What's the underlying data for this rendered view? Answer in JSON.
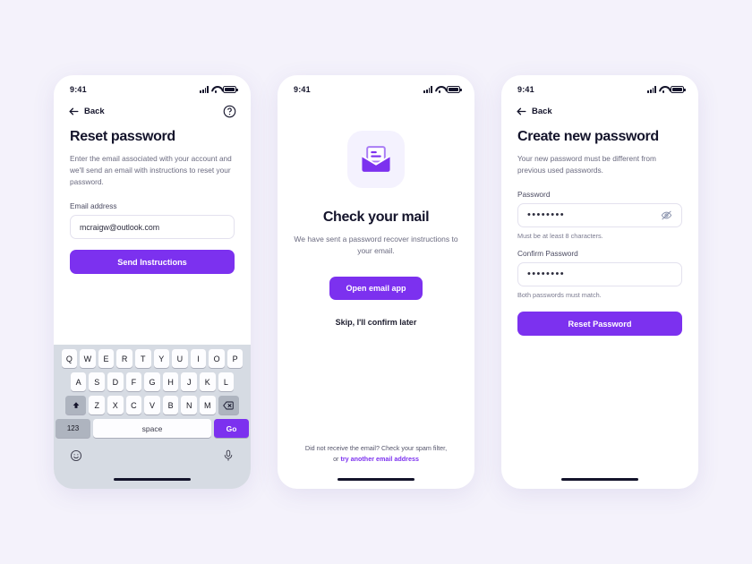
{
  "theme": {
    "accent": "#7c31ef",
    "page_bg": "#f4f2fb",
    "card_bg": "#ffffff",
    "keyboard_bg": "#d6dbe3",
    "text_primary": "#14142b",
    "text_muted": "#6b6b80",
    "tile_bg": "#f4f2fe"
  },
  "screens": [
    {
      "id": "reset-password",
      "status_bar": {
        "time": "9:41",
        "signal_icon": "signal-bars-icon",
        "wifi_icon": "wifi-icon",
        "battery_icon": "battery-icon"
      },
      "nav": {
        "back_label": "Back",
        "back_icon": "arrow-left-icon",
        "help_icon": "help-circle-icon"
      },
      "title": "Reset password",
      "subtitle": "Enter the email associated with your account and we'll send an email with instructions to reset your password.",
      "email_label": "Email address",
      "email_value": "mcraigw@outlook.com",
      "email_placeholder": "Email address",
      "submit_label": "Send Instructions",
      "keyboard": {
        "row1": [
          "Q",
          "W",
          "E",
          "R",
          "T",
          "Y",
          "U",
          "I",
          "O",
          "P"
        ],
        "row2": [
          "A",
          "S",
          "D",
          "F",
          "G",
          "H",
          "J",
          "K",
          "L"
        ],
        "row3": [
          "Z",
          "X",
          "C",
          "V",
          "B",
          "N",
          "M"
        ],
        "shift_icon": "shift-up-icon",
        "backspace_icon": "backspace-icon",
        "numeric_label": "123",
        "space_label": "space",
        "go_label": "Go",
        "emoji_icon": "emoji-smiley-icon",
        "mic_icon": "microphone-icon"
      }
    },
    {
      "id": "check-your-mail",
      "status_bar": {
        "time": "9:41",
        "signal_icon": "signal-bars-icon",
        "wifi_icon": "wifi-icon",
        "battery_icon": "battery-icon"
      },
      "illustration_icon": "open-envelope-mail-icon",
      "title": "Check your mail",
      "subtitle": "We have sent a password recover instructions to your email.",
      "primary_label": "Open email app",
      "skip_label": "Skip, I'll confirm later",
      "footnote_text": "Did not receive the email? Check your spam filter,",
      "footnote_prefix": "or ",
      "footnote_link": "try another email address"
    },
    {
      "id": "create-new-password",
      "status_bar": {
        "time": "9:41",
        "signal_icon": "signal-bars-icon",
        "wifi_icon": "wifi-icon",
        "battery_icon": "battery-icon"
      },
      "nav": {
        "back_label": "Back",
        "back_icon": "arrow-left-icon"
      },
      "title": "Create new password",
      "subtitle": "Your new password must be different from previous used passwords.",
      "password_label": "Password",
      "password_value": "••••••••",
      "password_hint": "Must be at least 8 characters.",
      "toggle_icon": "eye-off-icon",
      "confirm_label": "Confirm Password",
      "confirm_value": "••••••••",
      "confirm_hint": "Both passwords must match.",
      "submit_label": "Reset Password"
    }
  ]
}
